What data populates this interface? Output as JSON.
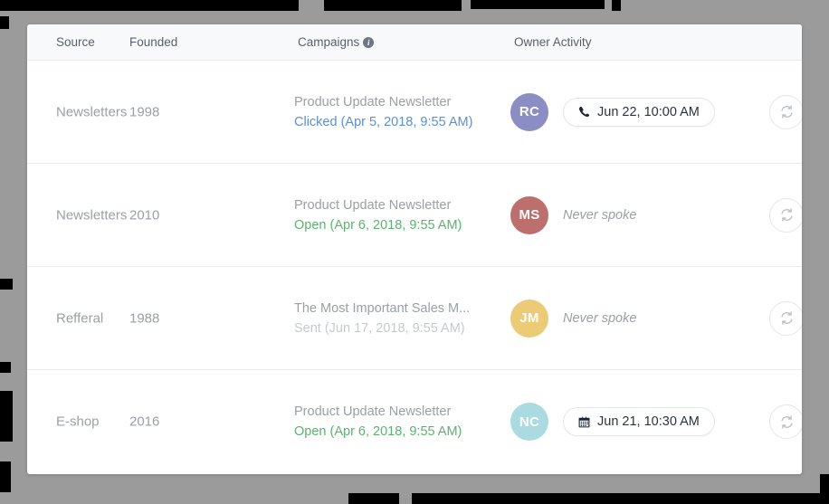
{
  "table": {
    "columns": [
      {
        "key": "source",
        "label": "Source"
      },
      {
        "key": "founded",
        "label": "Founded"
      },
      {
        "key": "campaigns",
        "label": "Campaigns",
        "info_icon": "info-icon"
      },
      {
        "key": "owner",
        "label": "Owner  Activity"
      }
    ],
    "rows": [
      {
        "source": "Newsletters",
        "founded": "1998",
        "campaign_title": "Product Update Newsletter",
        "campaign_status": "Clicked (Apr 5, 2018, 9:55 AM)",
        "campaign_status_type": "clicked",
        "avatar_initials": "RC",
        "avatar_color": "#8b8ec4",
        "activity_type": "call",
        "activity_icon": "phone-icon",
        "activity_label": "Jun 22, 10:00 AM",
        "refresh_icon": "refresh-icon"
      },
      {
        "source": "Newsletters",
        "founded": "2010",
        "campaign_title": "Product Update Newsletter",
        "campaign_status": "Open (Apr 6, 2018, 9:55 AM)",
        "campaign_status_type": "open",
        "avatar_initials": "MS",
        "avatar_color": "#bd6f6d",
        "activity_type": "none",
        "activity_icon": "",
        "activity_label": "Never spoke",
        "refresh_icon": "refresh-icon"
      },
      {
        "source": "Refferal",
        "founded": "1988",
        "campaign_title": "The Most Important Sales M...",
        "campaign_status": "Sent (Jun 17, 2018, 9:55 AM)",
        "campaign_status_type": "sent",
        "avatar_initials": "JM",
        "avatar_color": "#eccb76",
        "activity_type": "none",
        "activity_icon": "",
        "activity_label": "Never spoke",
        "refresh_icon": "refresh-icon"
      },
      {
        "source": "E-shop",
        "founded": "2016",
        "campaign_title": "Product Update Newsletter",
        "campaign_status": "Open (Apr 6, 2018, 9:55 AM)",
        "campaign_status_type": "open",
        "avatar_initials": "NC",
        "avatar_color": "#a9dbe0",
        "activity_type": "meeting",
        "activity_icon": "calendar-icon",
        "activity_label": "Jun 21, 10:30 AM",
        "refresh_icon": "refresh-icon"
      }
    ]
  },
  "colors": {
    "status_clicked": "#5b8fd4",
    "status_open": "#5cb270",
    "status_sent": "#c6cacd",
    "text_muted": "#9aa0a6",
    "header_bg": "#f8f9fa",
    "page_bg": "#9b9b9b",
    "card_bg": "#ffffff"
  }
}
